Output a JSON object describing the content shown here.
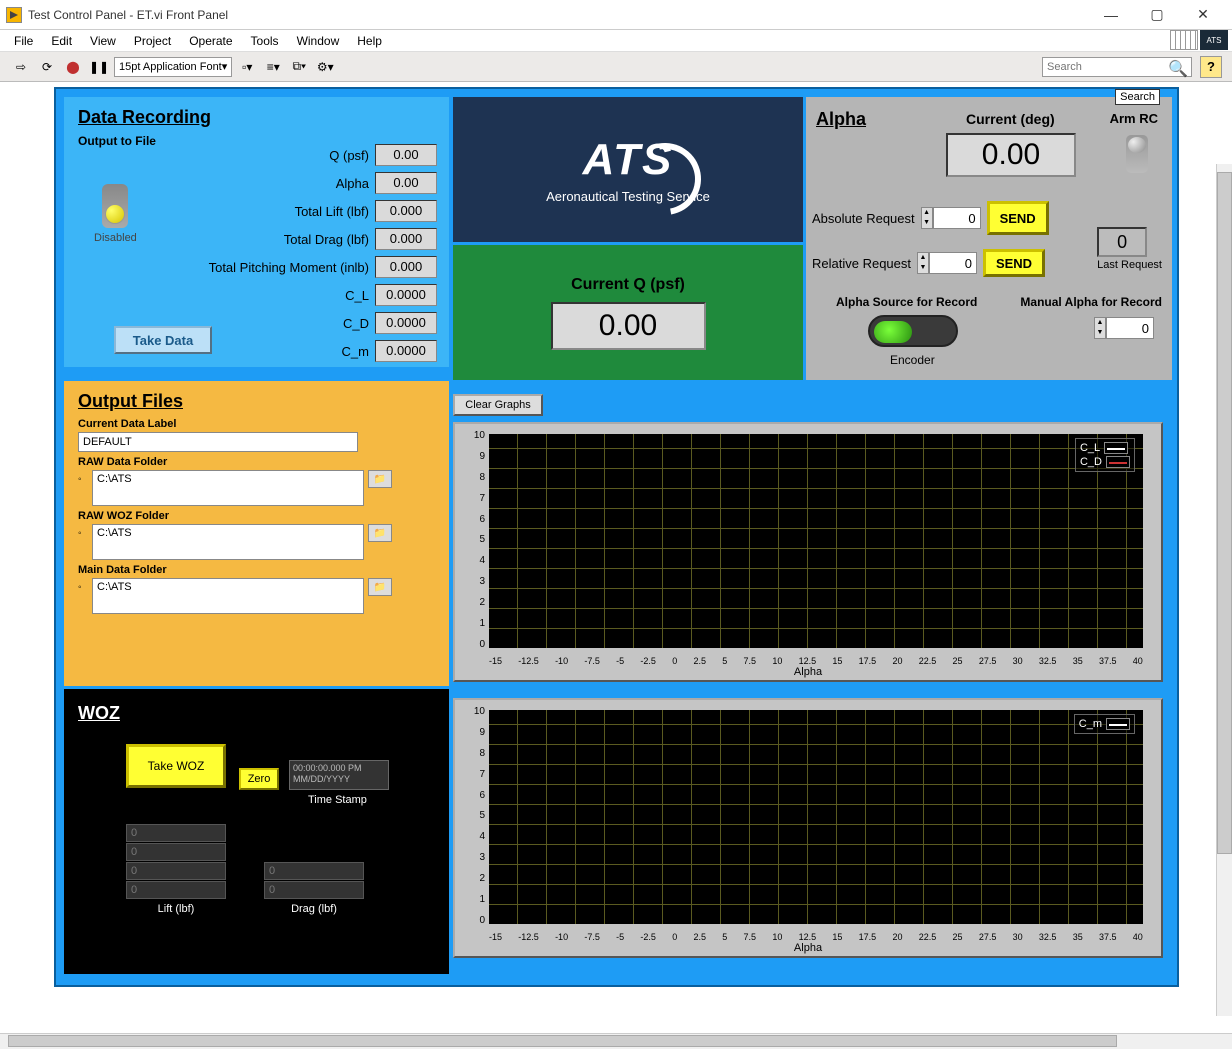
{
  "window": {
    "title": "Test Control Panel - ET.vi Front Panel"
  },
  "menu": [
    "File",
    "Edit",
    "View",
    "Project",
    "Operate",
    "Tools",
    "Window",
    "Help"
  ],
  "toolbar": {
    "font": "15pt Application Font",
    "search_placeholder": "Search",
    "search_tooltip": "Search"
  },
  "data_recording": {
    "heading": "Data Recording",
    "sub": "Output to File",
    "toggle_label": "Disabled",
    "take_data": "Take Data",
    "rows": [
      {
        "label": "Q (psf)",
        "value": "0.00"
      },
      {
        "label": "Alpha",
        "value": "0.00"
      },
      {
        "label": "Total Lift (lbf)",
        "value": "0.000"
      },
      {
        "label": "Total Drag (lbf)",
        "value": "0.000"
      },
      {
        "label": "Total Pitching Moment (inlb)",
        "value": "0.000"
      },
      {
        "label": "C_L",
        "value": "0.0000"
      },
      {
        "label": "C_D",
        "value": "0.0000"
      },
      {
        "label": "C_m",
        "value": "0.0000"
      }
    ]
  },
  "logo": {
    "name": "ATS",
    "tagline": "Aeronautical Testing Service"
  },
  "q_panel": {
    "label": "Current Q (psf)",
    "value": "0.00"
  },
  "alpha": {
    "heading": "Alpha",
    "current_label": "Current (deg)",
    "current_value": "0.00",
    "arm_label": "Arm RC",
    "abs_label": "Absolute Request",
    "abs_value": "0",
    "abs_send": "SEND",
    "rel_label": "Relative Request",
    "rel_value": "0",
    "rel_send": "SEND",
    "last_req_label": "Last Request",
    "last_req_value": "0",
    "source_label": "Alpha Source for Record",
    "encoder": "Encoder",
    "manual_label": "Manual Alpha for Record",
    "manual_value": "0"
  },
  "output_files": {
    "heading": "Output Files",
    "label_lbl": "Current Data Label",
    "label_val": "DEFAULT",
    "raw_lbl": "RAW Data Folder",
    "raw_val": "C:\\ATS",
    "woz_lbl": "RAW WOZ Folder",
    "woz_val": "C:\\ATS",
    "main_lbl": "Main Data Folder",
    "main_val": "C:\\ATS"
  },
  "woz": {
    "heading": "WOZ",
    "take": "Take WOZ",
    "zero": "Zero",
    "timestamp": "00:00:00.000 PM\nMM/DD/YYYY",
    "ts_label": "Time Stamp",
    "lift_label": "Lift (lbf)",
    "drag_label": "Drag (lbf)",
    "lift_vals": [
      "0",
      "0",
      "0",
      "0"
    ],
    "drag_vals": [
      "0",
      "0"
    ]
  },
  "graphs": {
    "clear": "Clear Graphs",
    "x_label": "Alpha",
    "y_ticks": [
      "10",
      "9",
      "8",
      "7",
      "6",
      "5",
      "4",
      "3",
      "2",
      "1",
      "0"
    ],
    "x_ticks": [
      "-15",
      "-12.5",
      "-10",
      "-7.5",
      "-5",
      "-2.5",
      "0",
      "2.5",
      "5",
      "7.5",
      "10",
      "12.5",
      "15",
      "17.5",
      "20",
      "22.5",
      "25",
      "27.5",
      "30",
      "32.5",
      "35",
      "37.5",
      "40"
    ],
    "legend1": [
      {
        "name": "C_L",
        "color": "#ffffff"
      },
      {
        "name": "C_D",
        "color": "#cc3333"
      }
    ],
    "legend2": [
      {
        "name": "C_m",
        "color": "#ffffff"
      }
    ]
  },
  "chart_data": [
    {
      "type": "line",
      "title": "",
      "xlabel": "Alpha",
      "ylabel": "",
      "xlim": [
        -15,
        40
      ],
      "ylim": [
        0,
        10
      ],
      "series": [
        {
          "name": "C_L",
          "values": []
        },
        {
          "name": "C_D",
          "values": []
        }
      ],
      "x": []
    },
    {
      "type": "line",
      "title": "",
      "xlabel": "Alpha",
      "ylabel": "",
      "xlim": [
        -15,
        40
      ],
      "ylim": [
        0,
        10
      ],
      "series": [
        {
          "name": "C_m",
          "values": []
        }
      ],
      "x": []
    }
  ]
}
